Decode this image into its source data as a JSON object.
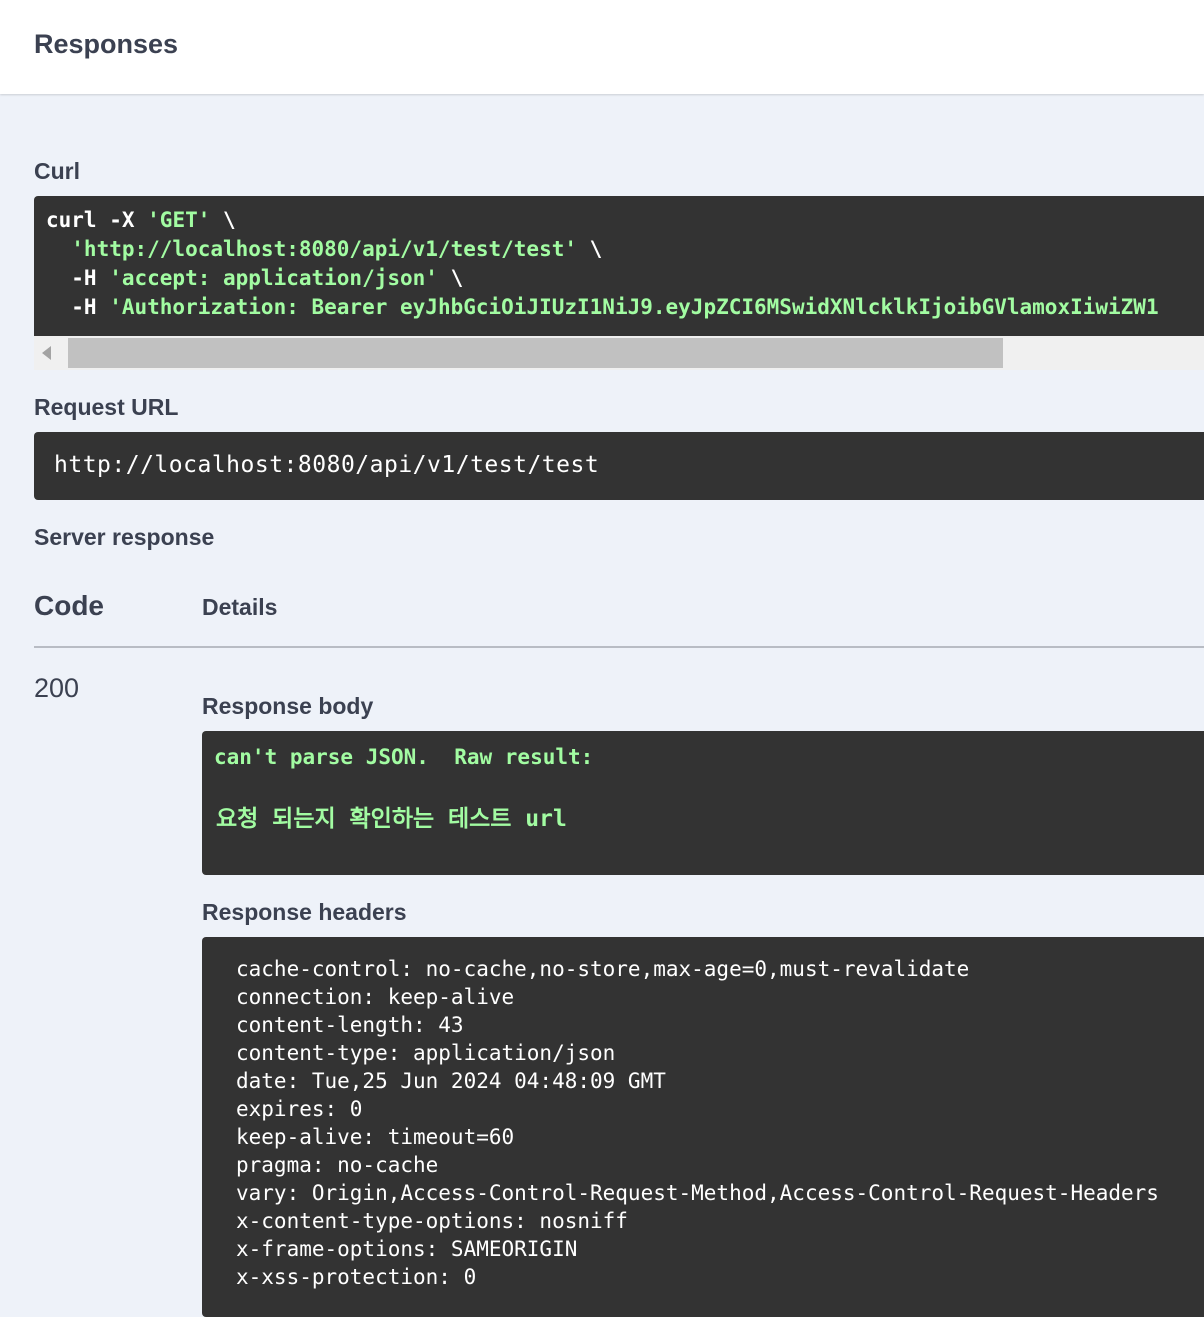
{
  "section": {
    "title": "Responses"
  },
  "curl": {
    "label": "Curl",
    "line1_plain": "curl -X ",
    "line1_str": "'GET'",
    "line1_end": " \\",
    "line2_str": "  'http://localhost:8080/api/v1/test/test'",
    "line2_end": " \\",
    "line3_plain": "  -H ",
    "line3_str": "'accept: application/json'",
    "line3_end": " \\",
    "line4_plain": "  -H ",
    "line4_str": "'Authorization: Bearer eyJhbGciOiJIUzI1NiJ9.eyJpZCI6MSwidXNlcklkIjoibGVlamoxIiwiZW1"
  },
  "request_url": {
    "label": "Request URL",
    "value": "http://localhost:8080/api/v1/test/test"
  },
  "server_response": {
    "label": "Server response",
    "col_code": "Code",
    "col_details": "Details",
    "status_code": "200",
    "body_label": "Response body",
    "body_line1": "can't parse JSON.  Raw result:",
    "body_line2": "요청 되는지 확인하는 테스트 url",
    "headers_label": "Response headers",
    "headers": [
      "cache-control: no-cache,no-store,max-age=0,must-revalidate",
      "connection: keep-alive",
      "content-length: 43",
      "content-type: application/json",
      "date: Tue,25 Jun 2024 04:48:09 GMT",
      "expires: 0",
      "keep-alive: timeout=60",
      "pragma: no-cache",
      "vary: Origin,Access-Control-Request-Method,Access-Control-Request-Headers",
      "x-content-type-options: nosniff",
      "x-frame-options: SAMEORIGIN",
      "x-xss-protection: 0"
    ]
  }
}
